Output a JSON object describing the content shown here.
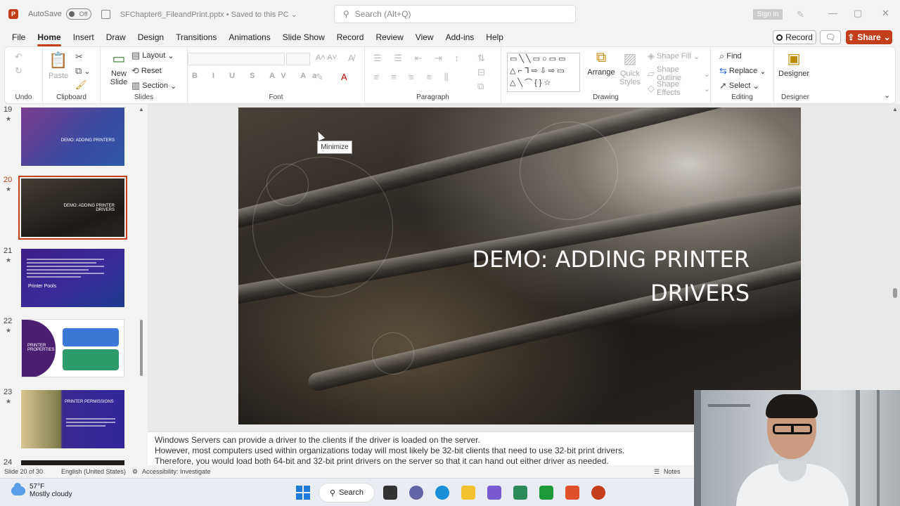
{
  "titlebar": {
    "autosave_label": "AutoSave",
    "autosave_state": "Off",
    "document": "SFChapter6_FileandPrint.pptx  •  Saved to this PC ⌄",
    "search_placeholder": "Search (Alt+Q)",
    "signin": "Sign in"
  },
  "menu": {
    "tabs": [
      "File",
      "Home",
      "Insert",
      "Draw",
      "Design",
      "Transitions",
      "Animations",
      "Slide Show",
      "Record",
      "Review",
      "View",
      "Add-ins",
      "Help"
    ],
    "record": "Record",
    "share": "Share"
  },
  "ribbon": {
    "undo_label": "Undo",
    "clipboard_label": "Clipboard",
    "paste": "Paste",
    "slides_label": "Slides",
    "new_slide": "New Slide",
    "layout": "Layout",
    "reset": "Reset",
    "section": "Section",
    "font_label": "Font",
    "paragraph_label": "Paragraph",
    "drawing_label": "Drawing",
    "arrange": "Arrange",
    "quick_styles": "Quick Styles",
    "shape_fill": "Shape Fill",
    "shape_outline": "Shape Outline",
    "shape_effects": "Shape Effects",
    "editing_label": "Editing",
    "find": "Find",
    "replace": "Replace",
    "select": "Select",
    "designer_label": "Designer",
    "designer": "Designer"
  },
  "thumbnails": {
    "nums": [
      "19",
      "20",
      "21",
      "22",
      "23",
      "24"
    ],
    "t19": "DEMO: ADDING PRINTERS",
    "t20": "DEMO: ADDING PRINTER DRIVERS",
    "t21": "Printer Pools",
    "t22": "PRINTER PROPERTIES",
    "t23": "PRINTER PERMISSIONS"
  },
  "slide": {
    "title": "DEMO: ADDING PRINTER\nDRIVERS"
  },
  "tooltip": "Minimize",
  "notes": [
    "Windows Servers can provide a driver to the clients if the driver is loaded on the server.",
    "However, most computers used within organizations today will most likely be 32-bit clients that need to use 32-bit print drivers.",
    "Therefore, you would load both 64-bit and 32-bit print drivers on the server so that it can hand out either driver as needed."
  ],
  "status": {
    "slide_count": "Slide 20 of 30",
    "language": "English (United States)",
    "accessibility": "Accessibility: Investigate",
    "notes_button": "Notes"
  },
  "taskbar": {
    "temperature": "57°F",
    "condition": "Mostly cloudy",
    "search": "Search"
  },
  "colors": {
    "accent": "#c43e1c",
    "slide_bg": "#1e1b18"
  }
}
